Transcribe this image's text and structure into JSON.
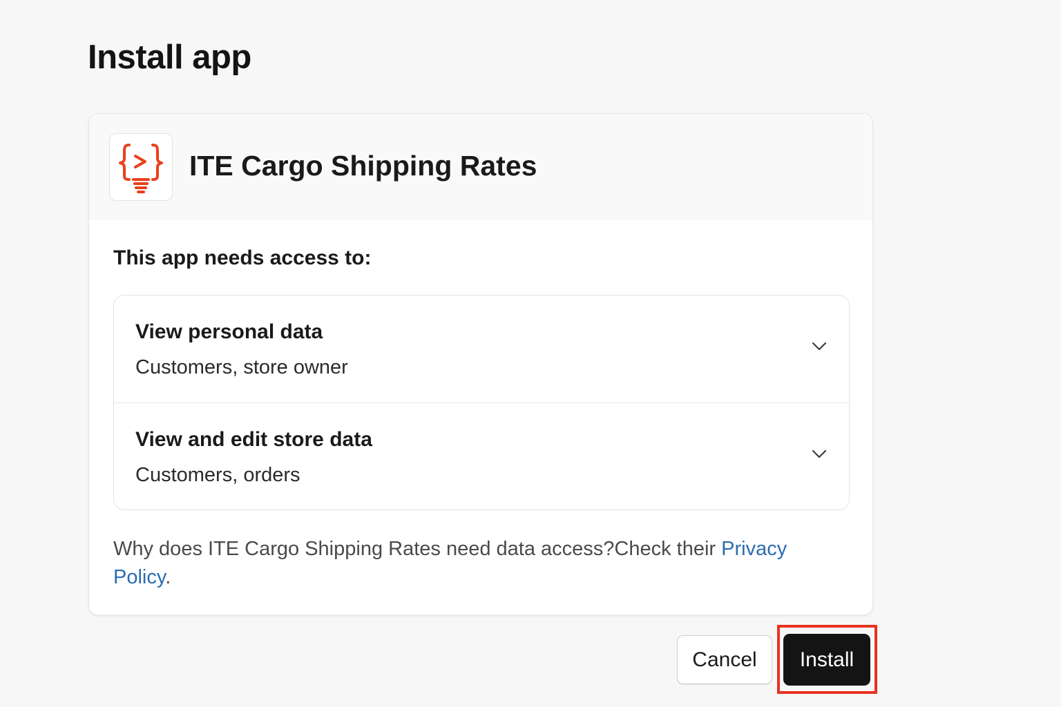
{
  "page": {
    "title": "Install app"
  },
  "app": {
    "name": "ITE Cargo Shipping Rates",
    "logo_icon": "code-lightbulb-icon",
    "logo_color": "#e8401c"
  },
  "access": {
    "heading": "This app needs access to:",
    "permissions": [
      {
        "title": "View personal data",
        "description": "Customers, store owner",
        "icon": "chevron-down-icon"
      },
      {
        "title": "View and edit store data",
        "description": "Customers, orders",
        "icon": "chevron-down-icon"
      }
    ],
    "footnote_text": "Why does ITE Cargo Shipping Rates need data access?Check their ",
    "privacy_link": "Privacy Policy",
    "footnote_end": "."
  },
  "actions": {
    "cancel_label": "Cancel",
    "install_label": "Install",
    "highlight_color": "#e8321e"
  }
}
